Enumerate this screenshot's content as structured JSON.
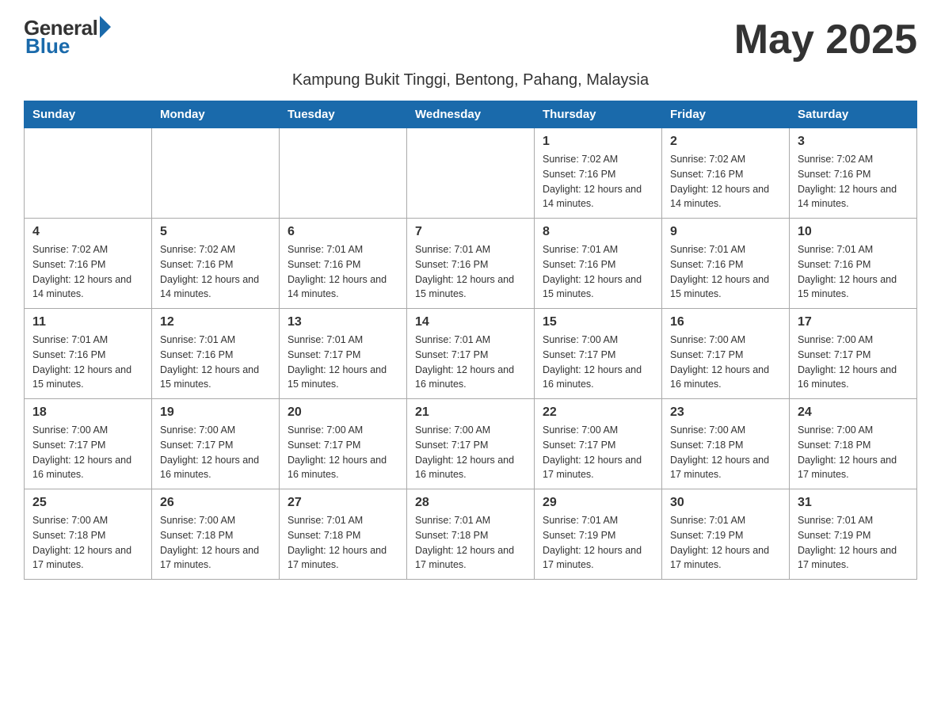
{
  "logo": {
    "general": "General",
    "blue": "Blue"
  },
  "title": "May 2025",
  "subtitle": "Kampung Bukit Tinggi, Bentong, Pahang, Malaysia",
  "days_of_week": [
    "Sunday",
    "Monday",
    "Tuesday",
    "Wednesday",
    "Thursday",
    "Friday",
    "Saturday"
  ],
  "weeks": [
    [
      {
        "day": "",
        "info": ""
      },
      {
        "day": "",
        "info": ""
      },
      {
        "day": "",
        "info": ""
      },
      {
        "day": "",
        "info": ""
      },
      {
        "day": "1",
        "info": "Sunrise: 7:02 AM\nSunset: 7:16 PM\nDaylight: 12 hours\nand 14 minutes."
      },
      {
        "day": "2",
        "info": "Sunrise: 7:02 AM\nSunset: 7:16 PM\nDaylight: 12 hours\nand 14 minutes."
      },
      {
        "day": "3",
        "info": "Sunrise: 7:02 AM\nSunset: 7:16 PM\nDaylight: 12 hours\nand 14 minutes."
      }
    ],
    [
      {
        "day": "4",
        "info": "Sunrise: 7:02 AM\nSunset: 7:16 PM\nDaylight: 12 hours\nand 14 minutes."
      },
      {
        "day": "5",
        "info": "Sunrise: 7:02 AM\nSunset: 7:16 PM\nDaylight: 12 hours\nand 14 minutes."
      },
      {
        "day": "6",
        "info": "Sunrise: 7:01 AM\nSunset: 7:16 PM\nDaylight: 12 hours\nand 14 minutes."
      },
      {
        "day": "7",
        "info": "Sunrise: 7:01 AM\nSunset: 7:16 PM\nDaylight: 12 hours\nand 15 minutes."
      },
      {
        "day": "8",
        "info": "Sunrise: 7:01 AM\nSunset: 7:16 PM\nDaylight: 12 hours\nand 15 minutes."
      },
      {
        "day": "9",
        "info": "Sunrise: 7:01 AM\nSunset: 7:16 PM\nDaylight: 12 hours\nand 15 minutes."
      },
      {
        "day": "10",
        "info": "Sunrise: 7:01 AM\nSunset: 7:16 PM\nDaylight: 12 hours\nand 15 minutes."
      }
    ],
    [
      {
        "day": "11",
        "info": "Sunrise: 7:01 AM\nSunset: 7:16 PM\nDaylight: 12 hours\nand 15 minutes."
      },
      {
        "day": "12",
        "info": "Sunrise: 7:01 AM\nSunset: 7:16 PM\nDaylight: 12 hours\nand 15 minutes."
      },
      {
        "day": "13",
        "info": "Sunrise: 7:01 AM\nSunset: 7:17 PM\nDaylight: 12 hours\nand 15 minutes."
      },
      {
        "day": "14",
        "info": "Sunrise: 7:01 AM\nSunset: 7:17 PM\nDaylight: 12 hours\nand 16 minutes."
      },
      {
        "day": "15",
        "info": "Sunrise: 7:00 AM\nSunset: 7:17 PM\nDaylight: 12 hours\nand 16 minutes."
      },
      {
        "day": "16",
        "info": "Sunrise: 7:00 AM\nSunset: 7:17 PM\nDaylight: 12 hours\nand 16 minutes."
      },
      {
        "day": "17",
        "info": "Sunrise: 7:00 AM\nSunset: 7:17 PM\nDaylight: 12 hours\nand 16 minutes."
      }
    ],
    [
      {
        "day": "18",
        "info": "Sunrise: 7:00 AM\nSunset: 7:17 PM\nDaylight: 12 hours\nand 16 minutes."
      },
      {
        "day": "19",
        "info": "Sunrise: 7:00 AM\nSunset: 7:17 PM\nDaylight: 12 hours\nand 16 minutes."
      },
      {
        "day": "20",
        "info": "Sunrise: 7:00 AM\nSunset: 7:17 PM\nDaylight: 12 hours\nand 16 minutes."
      },
      {
        "day": "21",
        "info": "Sunrise: 7:00 AM\nSunset: 7:17 PM\nDaylight: 12 hours\nand 16 minutes."
      },
      {
        "day": "22",
        "info": "Sunrise: 7:00 AM\nSunset: 7:17 PM\nDaylight: 12 hours\nand 17 minutes."
      },
      {
        "day": "23",
        "info": "Sunrise: 7:00 AM\nSunset: 7:18 PM\nDaylight: 12 hours\nand 17 minutes."
      },
      {
        "day": "24",
        "info": "Sunrise: 7:00 AM\nSunset: 7:18 PM\nDaylight: 12 hours\nand 17 minutes."
      }
    ],
    [
      {
        "day": "25",
        "info": "Sunrise: 7:00 AM\nSunset: 7:18 PM\nDaylight: 12 hours\nand 17 minutes."
      },
      {
        "day": "26",
        "info": "Sunrise: 7:00 AM\nSunset: 7:18 PM\nDaylight: 12 hours\nand 17 minutes."
      },
      {
        "day": "27",
        "info": "Sunrise: 7:01 AM\nSunset: 7:18 PM\nDaylight: 12 hours\nand 17 minutes."
      },
      {
        "day": "28",
        "info": "Sunrise: 7:01 AM\nSunset: 7:18 PM\nDaylight: 12 hours\nand 17 minutes."
      },
      {
        "day": "29",
        "info": "Sunrise: 7:01 AM\nSunset: 7:19 PM\nDaylight: 12 hours\nand 17 minutes."
      },
      {
        "day": "30",
        "info": "Sunrise: 7:01 AM\nSunset: 7:19 PM\nDaylight: 12 hours\nand 17 minutes."
      },
      {
        "day": "31",
        "info": "Sunrise: 7:01 AM\nSunset: 7:19 PM\nDaylight: 12 hours\nand 17 minutes."
      }
    ]
  ]
}
